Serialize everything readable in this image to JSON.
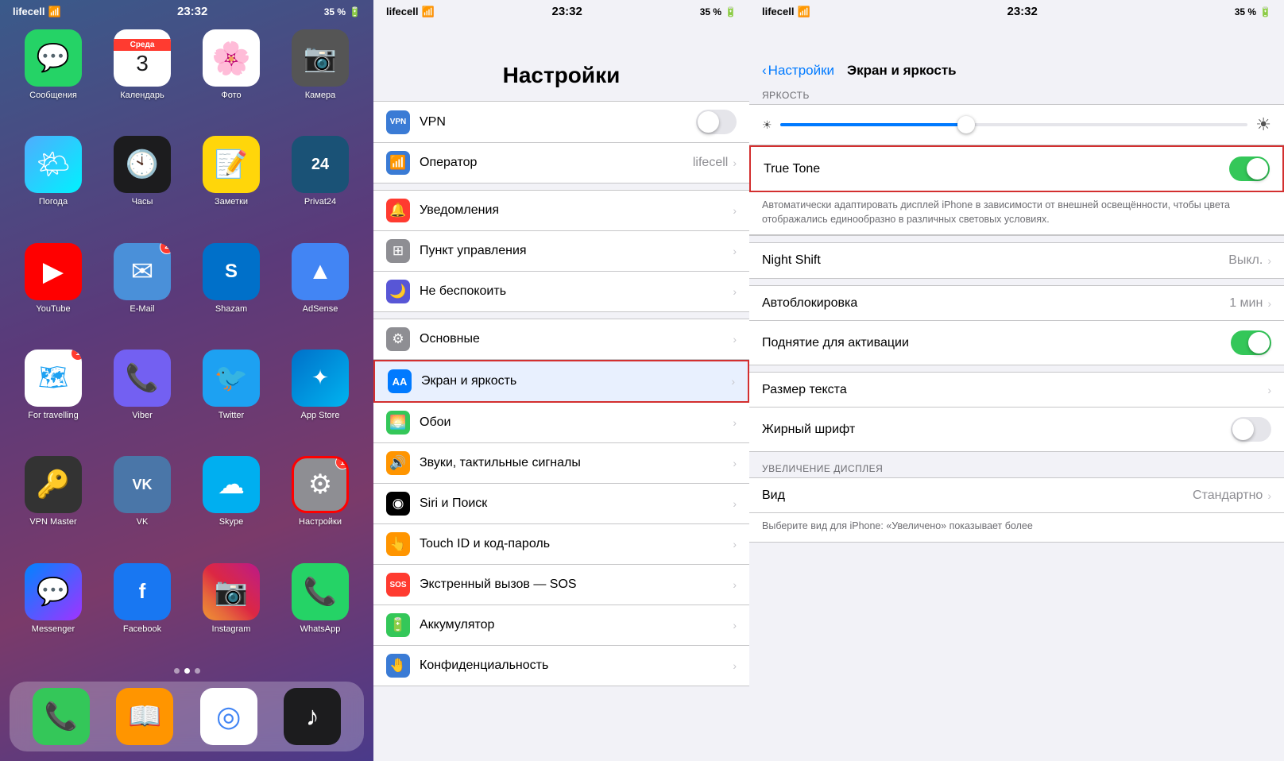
{
  "home": {
    "carrier": "lifecell",
    "time": "23:32",
    "battery": "35 %",
    "apps": [
      {
        "label": "Сообщения",
        "icon": "💬",
        "bg": "bg-green",
        "badge": null
      },
      {
        "label": "Календарь",
        "icon": "cal",
        "bg": "bg-calendar",
        "badge": null
      },
      {
        "label": "Фото",
        "icon": "🖼️",
        "bg": "bg-photos",
        "badge": null
      },
      {
        "label": "Камера",
        "icon": "📷",
        "bg": "bg-camera",
        "badge": null
      },
      {
        "label": "Погода",
        "icon": "🌤",
        "bg": "bg-weather",
        "badge": null
      },
      {
        "label": "Часы",
        "icon": "clock",
        "bg": "bg-clock",
        "badge": null
      },
      {
        "label": "Заметки",
        "icon": "📝",
        "bg": "bg-notes",
        "badge": null
      },
      {
        "label": "Privat24",
        "icon": "24",
        "bg": "bg-privat",
        "badge": null
      },
      {
        "label": "YouTube",
        "icon": "▶",
        "bg": "bg-youtube",
        "badge": null
      },
      {
        "label": "E-Mail",
        "icon": "✉",
        "bg": "bg-email",
        "badge": "2"
      },
      {
        "label": "Shazam",
        "icon": "𝗦",
        "bg": "bg-shazam",
        "badge": null
      },
      {
        "label": "AdSense",
        "icon": "▲",
        "bg": "bg-adsense",
        "badge": null
      },
      {
        "label": "For travelling",
        "icon": "🗺",
        "bg": "bg-maps",
        "badge": "1"
      },
      {
        "label": "Viber",
        "icon": "📞",
        "bg": "bg-viber",
        "badge": null
      },
      {
        "label": "Twitter",
        "icon": "🐦",
        "bg": "bg-twitter",
        "badge": null
      },
      {
        "label": "App Store",
        "icon": "✦",
        "bg": "bg-appstore",
        "badge": null
      },
      {
        "label": "VPN Master",
        "icon": "🔑",
        "bg": "bg-vpnmaster",
        "badge": null
      },
      {
        "label": "VK",
        "icon": "VK",
        "bg": "bg-vk",
        "badge": null
      },
      {
        "label": "Skype",
        "icon": "☁",
        "bg": "bg-skype",
        "badge": null
      },
      {
        "label": "Настройки",
        "icon": "⚙",
        "bg": "bg-settings",
        "badge": "1",
        "highlight": true
      },
      {
        "label": "Messenger",
        "icon": "💬",
        "bg": "bg-messenger",
        "badge": null
      },
      {
        "label": "Facebook",
        "icon": "f",
        "bg": "bg-blue",
        "badge": null
      },
      {
        "label": "Instagram",
        "icon": "📷",
        "bg": "bg-instagram",
        "badge": null
      },
      {
        "label": "WhatsApp",
        "icon": "📞",
        "bg": "bg-whatsapp",
        "badge": null
      }
    ],
    "dock": [
      {
        "label": "Телефон",
        "icon": "📞",
        "bg": "bg-phone"
      },
      {
        "label": "Книги",
        "icon": "📖",
        "bg": "bg-books"
      },
      {
        "label": "Chrome",
        "icon": "◎",
        "bg": "bg-chrome"
      },
      {
        "label": "Музыка",
        "icon": "♪",
        "bg": "bg-music"
      }
    ]
  },
  "settings": {
    "title": "Настройки",
    "rows_top": [
      {
        "label": "VPN",
        "icon": "VPN",
        "iconBg": "#3a7bd5",
        "value": "",
        "hasToggle": true
      },
      {
        "label": "Оператор",
        "icon": "📶",
        "iconBg": "#3a7bd5",
        "value": "lifecell",
        "hasChevron": true
      }
    ],
    "rows_middle": [
      {
        "label": "Уведомления",
        "icon": "🔔",
        "iconBg": "#ff3b30",
        "value": "",
        "hasChevron": true
      },
      {
        "label": "Пункт управления",
        "icon": "⊞",
        "iconBg": "#8e8e93",
        "value": "",
        "hasChevron": true
      },
      {
        "label": "Не беспокоить",
        "icon": "🌙",
        "iconBg": "#5856d6",
        "value": "",
        "hasChevron": true
      }
    ],
    "rows_bottom": [
      {
        "label": "Основные",
        "icon": "⚙",
        "iconBg": "#8e8e93",
        "value": "",
        "hasChevron": true
      },
      {
        "label": "Экран и яркость",
        "icon": "AA",
        "iconBg": "#007aff",
        "value": "",
        "hasChevron": true,
        "highlight": true
      },
      {
        "label": "Обои",
        "icon": "🌅",
        "iconBg": "#34c759",
        "value": "",
        "hasChevron": true
      },
      {
        "label": "Звуки, тактильные сигналы",
        "icon": "🔊",
        "iconBg": "#ff9500",
        "value": "",
        "hasChevron": true
      },
      {
        "label": "Siri и Поиск",
        "icon": "◉",
        "iconBg": "#000",
        "value": "",
        "hasChevron": true
      },
      {
        "label": "Touch ID и код-пароль",
        "icon": "👆",
        "iconBg": "#ff9500",
        "value": "",
        "hasChevron": true
      },
      {
        "label": "Экстренный вызов — SOS",
        "icon": "SOS",
        "iconBg": "#ff3b30",
        "value": "",
        "hasChevron": true
      },
      {
        "label": "Аккумулятор",
        "icon": "🔋",
        "iconBg": "#34c759",
        "value": "",
        "hasChevron": true
      },
      {
        "label": "Конфиденциальность",
        "icon": "🤚",
        "iconBg": "#3a7bd5",
        "value": "",
        "hasChevron": true
      }
    ]
  },
  "detail": {
    "back_label": "Настройки",
    "title": "Экран и яркость",
    "section_brightness": "ЯРКОСТЬ",
    "truetone_label": "True Tone",
    "truetone_desc": "Автоматически адаптировать дисплей iPhone в зависимости от внешней освещённости, чтобы цвета отображались единообразно в различных световых условиях.",
    "nightshift_label": "Night Shift",
    "nightshift_value": "Выкл.",
    "autoblocklock_label": "Автоблокировка",
    "autoblocklock_value": "1 мин",
    "raise_to_wake_label": "Поднятие для активации",
    "textsize_label": "Размер текста",
    "bold_label": "Жирный шрифт",
    "section_zoom": "УВЕЛИЧЕНИЕ ДИСПЛЕЯ",
    "view_label": "Вид",
    "view_value": "Стандартно",
    "view_desc": "Выберите вид для iPhone: «Увеличено» показывает более"
  }
}
